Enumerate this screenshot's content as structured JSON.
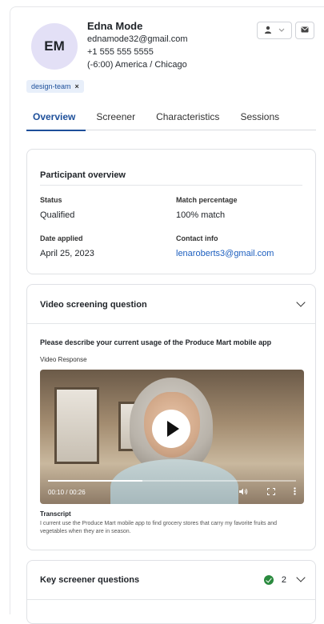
{
  "participant": {
    "initials": "EM",
    "name": "Edna Mode",
    "email": "ednamode32@gmail.com",
    "phone": "+1 555 555 5555",
    "timezone": "(-6:00) America / Chicago"
  },
  "header_actions": {
    "user_icon": "user-icon",
    "mail_icon": "mail-icon"
  },
  "tag": {
    "label": "design-team",
    "remove": "×"
  },
  "tabs": [
    {
      "label": "Overview",
      "active": true
    },
    {
      "label": "Screener"
    },
    {
      "label": "Characteristics"
    },
    {
      "label": "Sessions"
    }
  ],
  "overview": {
    "title": "Participant overview",
    "status_label": "Status",
    "status": "Qualified",
    "match_label": "Match percentage",
    "match": "100% match",
    "date_label": "Date applied",
    "date": "April 25, 2023",
    "contact_label": "Contact info",
    "contact": "lenaroberts3@gmail.com"
  },
  "video_screening": {
    "title": "Video screening question",
    "question": "Please describe your current usage of the Produce Mart mobile app",
    "response_label": "Video Response",
    "time": "00:10 / 00:26",
    "progress": 0.38,
    "transcript_label": "Transcript",
    "transcript": "I current use the Produce Mart mobile app to find grocery stores that carry my favorite fruits and vegetables when they are in season."
  },
  "key_screener": {
    "title": "Key screener questions",
    "count": "2"
  }
}
